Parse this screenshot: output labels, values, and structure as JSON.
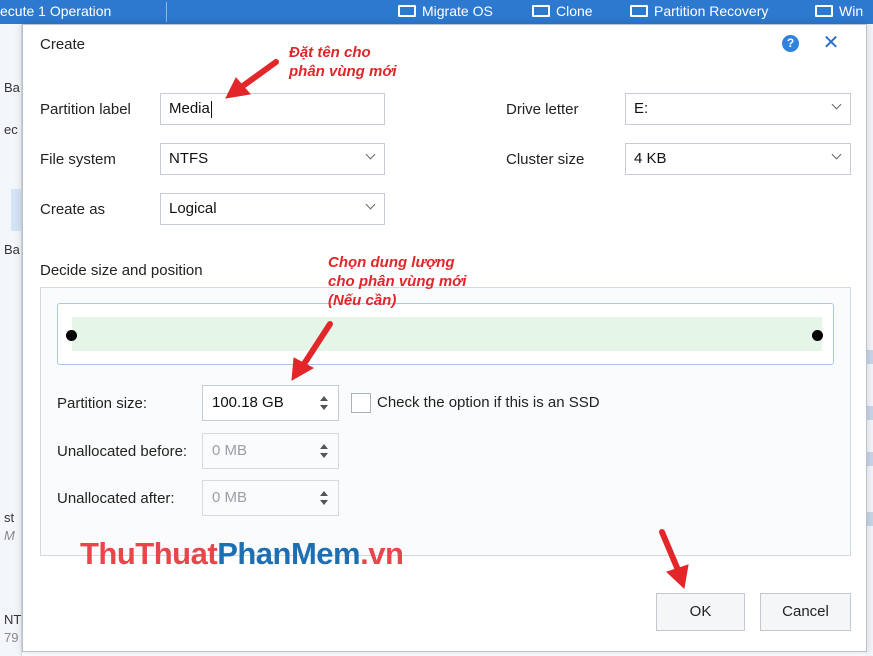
{
  "background_app": {
    "toolbar": {
      "execute_label": "ecute 1 Operation",
      "migrate_label": "Migrate OS",
      "clone_label": "Clone",
      "recovery_label": "Partition Recovery",
      "win_label": "Win"
    },
    "left_fragments": [
      "Ba",
      "ec",
      "Ba",
      "st",
      "M",
      "NT",
      "79"
    ]
  },
  "dialog": {
    "title": "Create",
    "help_glyph": "?",
    "close_glyph": "✕",
    "partition_label": {
      "label": "Partition label",
      "value": "Media"
    },
    "drive_letter": {
      "label": "Drive letter",
      "value": "E:"
    },
    "file_system": {
      "label": "File system",
      "value": "NTFS"
    },
    "cluster_size": {
      "label": "Cluster size",
      "value": "4 KB"
    },
    "create_as": {
      "label": "Create as",
      "value": "Logical"
    },
    "size_section_title": "Decide size and position",
    "size_bar_fill_fraction": 1.0,
    "partition_size": {
      "label": "Partition size:",
      "value": "100.18 GB"
    },
    "ssd_option": {
      "label": "Check the option if this is an SSD",
      "checked": false
    },
    "unallocated_before": {
      "label": "Unallocated before:",
      "value": "0 MB"
    },
    "unallocated_after": {
      "label": "Unallocated after:",
      "value": "0 MB"
    },
    "ok_button": "OK",
    "cancel_button": "Cancel"
  },
  "annotations": {
    "name_note_line1": "Đặt tên cho",
    "name_note_line2": "phân vùng mới",
    "size_note_line1": "Chọn dung lượng",
    "size_note_line2": "cho phân vùng mới",
    "size_note_line3": "(Nếu cần)"
  },
  "watermark": {
    "part1": "ThuThuat",
    "part2": "PhanMem",
    "part3": ".vn"
  },
  "colors": {
    "toolbar_blue": "#2c79cf",
    "annotation_red": "#e0262a",
    "size_fill_green": "#e5f5e8",
    "watermark_red": "#e6474a",
    "watermark_blue": "#1c6fb3"
  }
}
